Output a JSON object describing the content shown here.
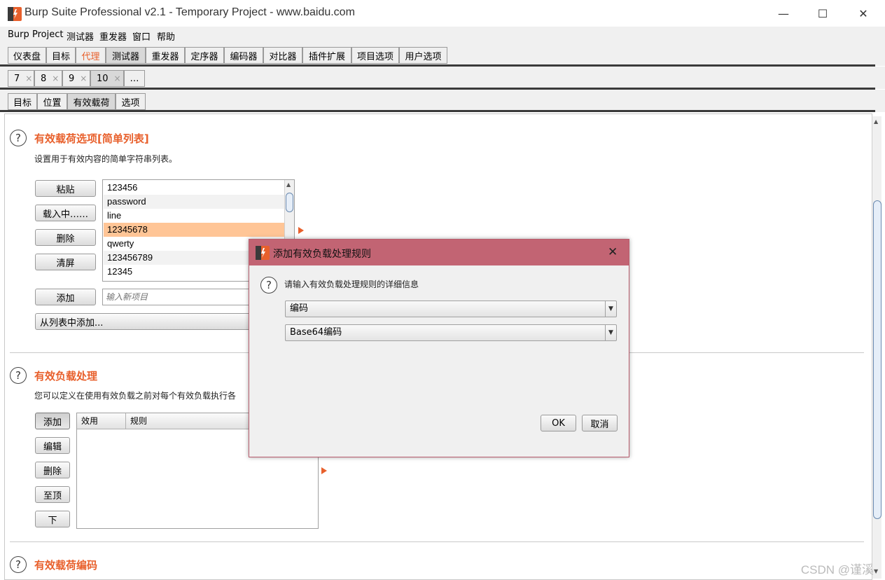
{
  "window": {
    "title": "Burp Suite Professional v2.1 - Temporary Project - www.baidu.com",
    "minimize_glyph": "—",
    "maximize_glyph": "☐",
    "close_glyph": "✕"
  },
  "menubar": [
    "Burp",
    "Project",
    "测试器",
    "重发器",
    "窗口",
    "帮助"
  ],
  "main_tabs": [
    "仪表盘",
    "目标",
    "代理",
    "测试器",
    "重发器",
    "定序器",
    "编码器",
    "对比器",
    "插件扩展",
    "项目选项",
    "用户选项"
  ],
  "attack_tabs": [
    {
      "label": "7",
      "close": "×"
    },
    {
      "label": "8",
      "close": "×"
    },
    {
      "label": "9",
      "close": "×"
    },
    {
      "label": "10",
      "close": "×"
    },
    {
      "label": "…",
      "close": ""
    }
  ],
  "sub_tabs": [
    "目标",
    "位置",
    "有效载荷",
    "选项"
  ],
  "payload_options": {
    "title": "有效载荷选项[简单列表]",
    "description": "设置用于有效内容的简单字符串列表。",
    "buttons": [
      "粘贴",
      "载入中……",
      "删除",
      "清屏"
    ],
    "items": [
      "123456",
      "password",
      "line",
      "12345678",
      "qwerty",
      "123456789",
      "12345"
    ],
    "selected_index": 3,
    "add_button": "添加",
    "add_placeholder": "输入新项目",
    "add_from_list": "从列表中添加..."
  },
  "payload_processing": {
    "title": "有效负载处理",
    "description": "您可以定义在使用有效负载之前对每个有效负载执行各",
    "buttons": [
      "添加",
      "编辑",
      "删除",
      "至顶",
      "下"
    ],
    "columns": [
      "效用",
      "规则"
    ]
  },
  "payload_encoding": {
    "title": "有效载荷编码"
  },
  "dialog": {
    "title": "添加有效负载处理规则",
    "close_glyph": "✕",
    "prompt": "请输入有效负载处理规则的详细信息",
    "rule_type": "编码",
    "rule_option": "Base64编码",
    "ok": "OK",
    "cancel": "取消"
  },
  "watermark": "CSDN @谨溪",
  "colors": {
    "accent": "#e8602c",
    "selected_row": "#ffc596",
    "dialog_titlebar": "#c26473"
  }
}
